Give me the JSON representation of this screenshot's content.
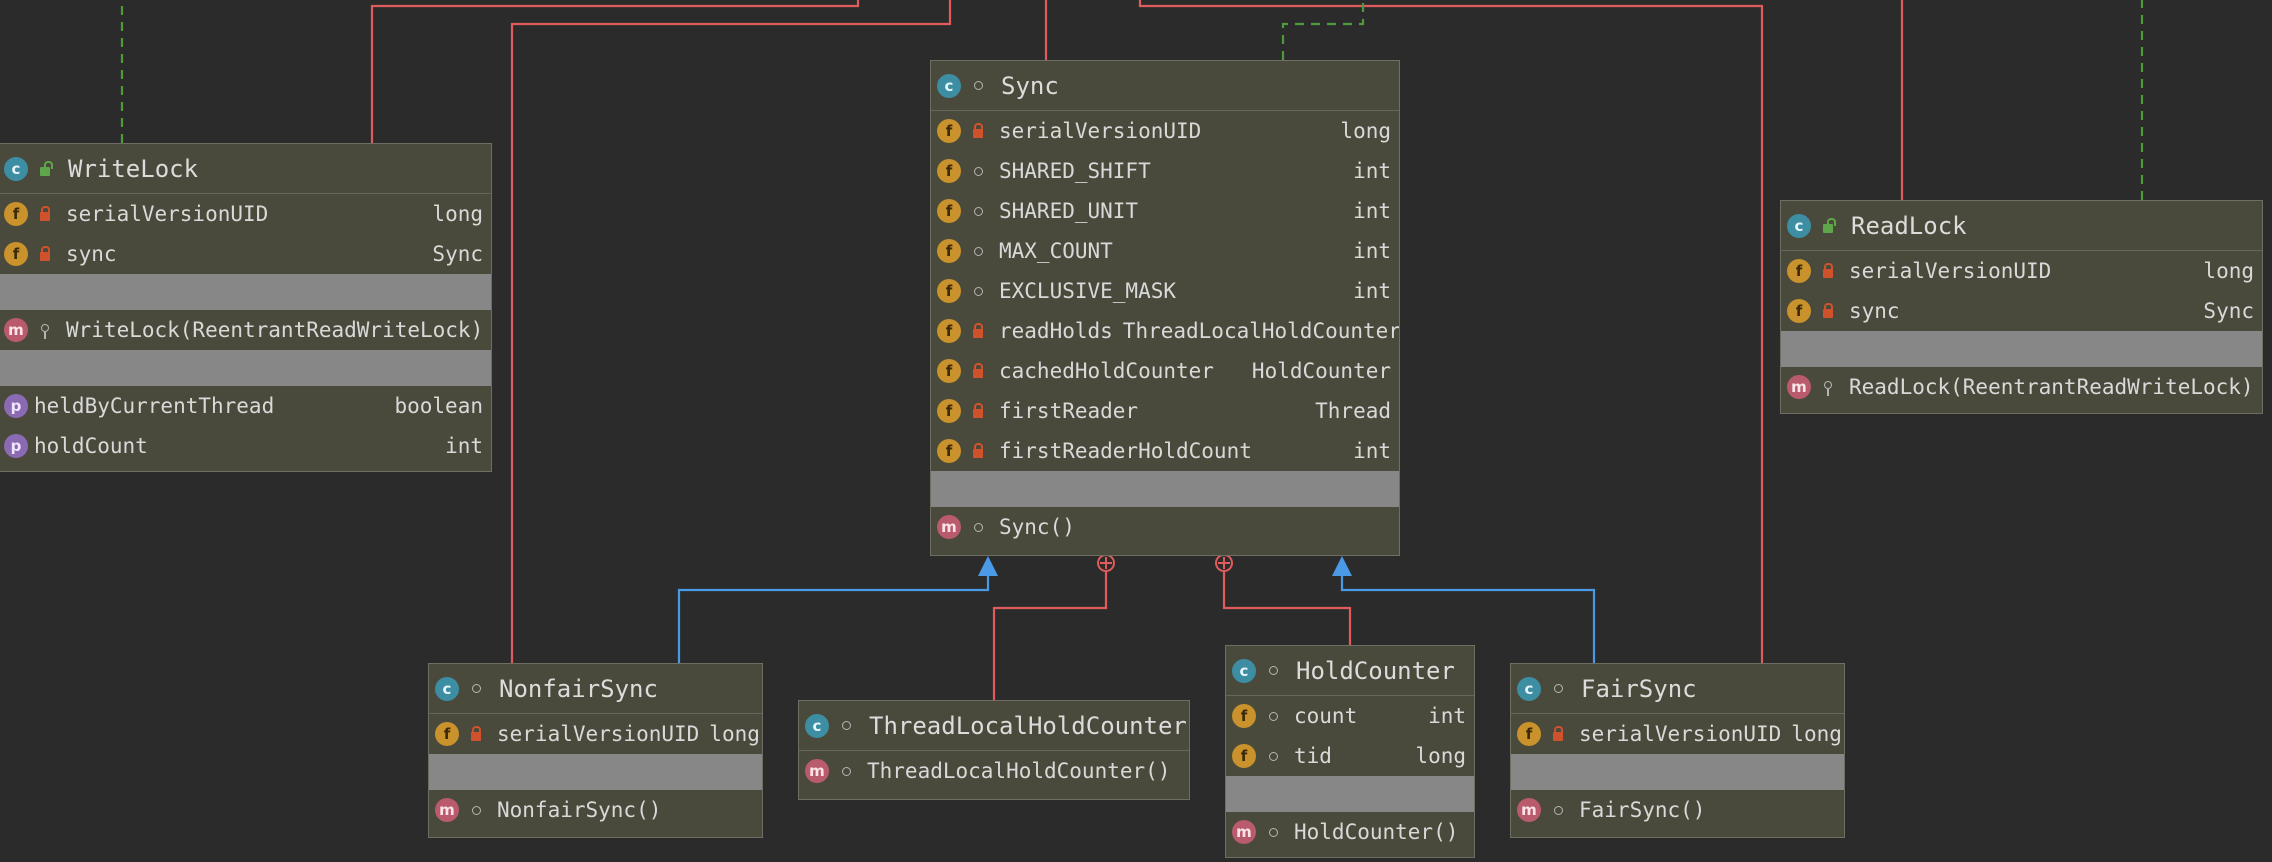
{
  "colors": {
    "background": "#2b2b2b",
    "box_fill": "#4a4a3c",
    "inner_class_edge": "#e05c5c",
    "inheritance_edge": "#4a9ae8",
    "realization_edge": "#4d9a3a"
  },
  "classes": {
    "sync": {
      "name": "Sync",
      "fields": [
        {
          "name": "serialVersionUID",
          "type": "long"
        },
        {
          "name": "SHARED_SHIFT",
          "type": "int"
        },
        {
          "name": "SHARED_UNIT",
          "type": "int"
        },
        {
          "name": "MAX_COUNT",
          "type": "int"
        },
        {
          "name": "EXCLUSIVE_MASK",
          "type": "int"
        },
        {
          "name": "readHolds",
          "type": "ThreadLocalHoldCounter"
        },
        {
          "name": "cachedHoldCounter",
          "type": "HoldCounter"
        },
        {
          "name": "firstReader",
          "type": "Thread"
        },
        {
          "name": "firstReaderHoldCount",
          "type": "int"
        }
      ],
      "methods": [
        "Sync()"
      ]
    },
    "write_lock": {
      "name": "WriteLock",
      "fields": [
        {
          "name": "serialVersionUID",
          "type": "long"
        },
        {
          "name": "sync",
          "type": "Sync"
        }
      ],
      "methods": [
        "WriteLock(ReentrantReadWriteLock)"
      ],
      "properties": [
        {
          "name": "heldByCurrentThread",
          "type": "boolean"
        },
        {
          "name": "holdCount",
          "type": "int"
        }
      ]
    },
    "read_lock": {
      "name": "ReadLock",
      "fields": [
        {
          "name": "serialVersionUID",
          "type": "long"
        },
        {
          "name": "sync",
          "type": "Sync"
        }
      ],
      "methods": [
        "ReadLock(ReentrantReadWriteLock)"
      ]
    },
    "nonfair_sync": {
      "name": "NonfairSync",
      "fields": [
        {
          "name": "serialVersionUID",
          "type": "long"
        }
      ],
      "methods": [
        "NonfairSync()"
      ]
    },
    "thread_local_hold_counter": {
      "name": "ThreadLocalHoldCounter",
      "methods": [
        "ThreadLocalHoldCounter()"
      ]
    },
    "hold_counter": {
      "name": "HoldCounter",
      "fields": [
        {
          "name": "count",
          "type": "int"
        },
        {
          "name": "tid",
          "type": "long"
        }
      ],
      "methods": [
        "HoldCounter()"
      ]
    },
    "fair_sync": {
      "name": "FairSync",
      "fields": [
        {
          "name": "serialVersionUID",
          "type": "long"
        }
      ],
      "methods": [
        "FairSync()"
      ]
    }
  },
  "icons": {
    "class": "c",
    "field": "f",
    "method": "m",
    "property": "p"
  }
}
